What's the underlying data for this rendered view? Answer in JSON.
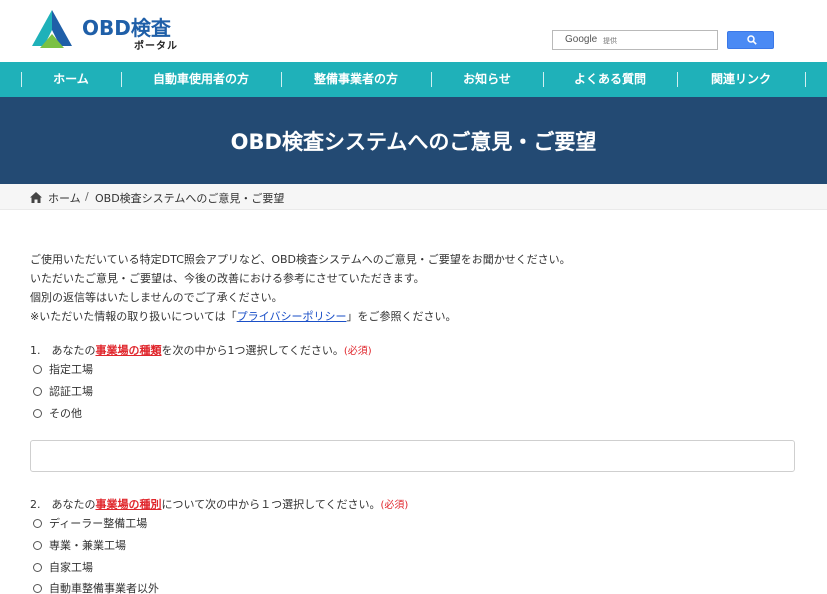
{
  "logo": {
    "title": "OBD検査",
    "subtitle": "ポータル"
  },
  "search": {
    "brand": "Google",
    "provider": "提供",
    "button_icon": "search-icon"
  },
  "nav": {
    "items": [
      {
        "label": "ホーム"
      },
      {
        "label": "自動車使用者の方"
      },
      {
        "label": "整備事業者の方"
      },
      {
        "label": "お知らせ"
      },
      {
        "label": "よくある質問"
      },
      {
        "label": "関連リンク"
      }
    ]
  },
  "banner": {
    "title": "OBD検査システムへのご意見・ご要望"
  },
  "breadcrumb": {
    "home": "ホーム",
    "separator": "/",
    "current": "OBD検査システムへのご意見・ご要望",
    "home_icon": "home-icon"
  },
  "intro": {
    "line1": "ご使用いただいている特定DTC照会アプリなど、OBD検査システムへのご意見・ご要望をお聞かせください。",
    "line2": "いただいたご意見・ご要望は、今後の改善における参考にさせていただきます。",
    "line3": "個別の返信等はいたしませんのでご了承ください。",
    "line4_before": "※いただいた情報の取り扱いについては「",
    "line4_link": "プライバシーポリシー",
    "line4_after": "」をご参照ください。"
  },
  "q1": {
    "prefix": "1.　あなたの",
    "emphasis": "事業場の種類",
    "suffix": "を次の中から1つ選択してください。",
    "required": "(必須)",
    "options": [
      "指定工場",
      "認証工場",
      "その他"
    ]
  },
  "q2": {
    "prefix": "2.　あなたの",
    "emphasis": "事業場の種別",
    "suffix": "について次の中から１つ選択してください。",
    "required": "(必須)",
    "options": [
      "ディーラー整備工場",
      "専業・兼業工場",
      "自家工場",
      "自動車整備事業者以外"
    ]
  },
  "colors": {
    "nav": "#1fb1b9",
    "banner": "#234a73",
    "logo": "#1f5fa8",
    "required": "#e0262c",
    "link": "#1a4fc7"
  }
}
